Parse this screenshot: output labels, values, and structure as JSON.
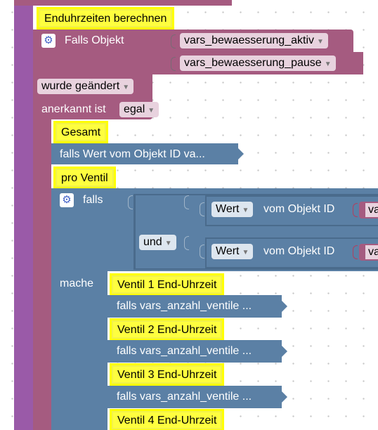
{
  "blocks": {
    "top_comment": "Enduhrzeiten berechnen",
    "trigger": {
      "label": "Falls Objekt",
      "objects": [
        "vars_bewaesserung_aktiv",
        "vars_bewaesserung_pause"
      ],
      "changed_select": "wurde geändert",
      "ack_label": "anerkannt ist",
      "ack_select": "egal"
    },
    "gesamt_comment": "Gesamt",
    "falls_wert_collapsed": "falls Wert vom Objekt ID va...",
    "pro_ventil_comment": "pro Ventil",
    "if_block": {
      "falls_label": "falls",
      "und_select": "und",
      "wert_select": "Wert",
      "vom_objekt": "vom Objekt ID",
      "va_stub": "va",
      "mache_label": "mache"
    },
    "ventile": [
      {
        "comment": "Ventil 1 End-Uhrzeit",
        "collapsed": "falls vars_anzahl_ventile ..."
      },
      {
        "comment": "Ventil 2 End-Uhrzeit",
        "collapsed": "falls vars_anzahl_ventile ..."
      },
      {
        "comment": "Ventil 3 End-Uhrzeit",
        "collapsed": "falls vars_anzahl_ventile ..."
      },
      {
        "comment": "Ventil 4 End-Uhrzeit",
        "collapsed": ""
      }
    ]
  },
  "colors": {
    "logic": "#5b80a5",
    "event": "#a55b80",
    "comment": "#fefe3f",
    "outer": "#9a5aa8"
  },
  "icons": {
    "gear": "gear-icon",
    "dropdown": "chevron-down-icon"
  }
}
